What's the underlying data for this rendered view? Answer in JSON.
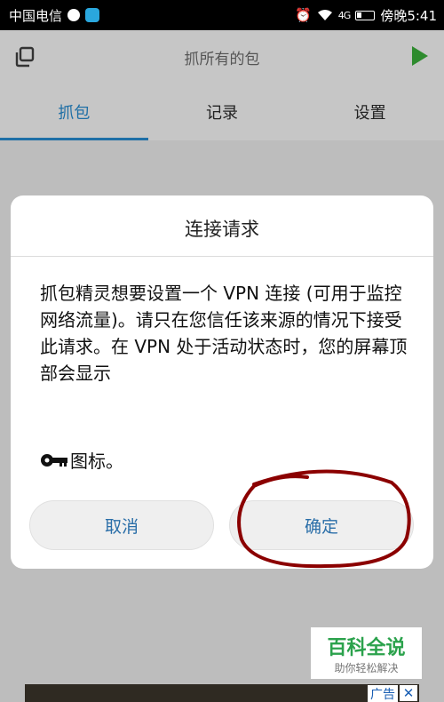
{
  "status_bar": {
    "carrier": "中国电信",
    "signal": "4G",
    "time_label": "傍晚5:41"
  },
  "toolbar": {
    "title": "抓所有的包"
  },
  "tabs": [
    "抓包",
    "记录",
    "设置"
  ],
  "dialog": {
    "title": "连接请求",
    "message": "抓包精灵想要设置一个 VPN 连接 (可用于监控网络流量)。请只在您信任该来源的情况下接受此请求。在 VPN 处于活动状态时，您的屏幕顶部会显示",
    "footer_suffix": "图标。",
    "cancel_label": "取消",
    "ok_label": "确定"
  },
  "watermark": {
    "title": "百科全说",
    "subtitle": "助你轻松解决"
  },
  "ad": {
    "label": "广告",
    "close": "✕"
  },
  "colors": {
    "accent": "#1f6fa6",
    "play": "#2e8b2e",
    "annotation": "#8b0000",
    "watermark_green": "#2ba24c"
  }
}
